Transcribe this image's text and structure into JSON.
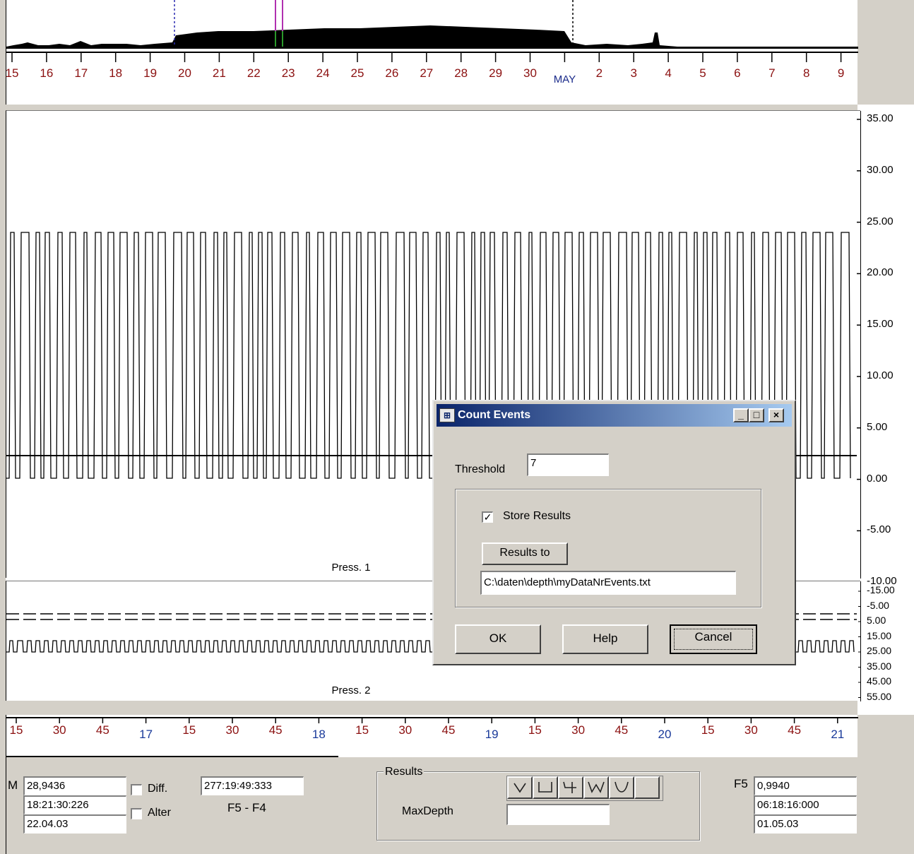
{
  "overview": {
    "date_ticks": [
      "15",
      "16",
      "17",
      "18",
      "19",
      "20",
      "21",
      "22",
      "23",
      "24",
      "25",
      "26",
      "27",
      "28",
      "29",
      "30",
      "MAY",
      "2",
      "3",
      "4",
      "5",
      "6",
      "7",
      "8",
      "9"
    ]
  },
  "chart1": {
    "caption": "Press. 1",
    "y_ticks": [
      "35.00",
      "30.00",
      "25.00",
      "20.00",
      "15.00",
      "10.00",
      "5.00",
      "0.00",
      "-5.00",
      "-10.00"
    ]
  },
  "chart2": {
    "caption": "Press. 2",
    "y_ticks": [
      "-15.00",
      "-5.00",
      "5.00",
      "15.00",
      "25.00",
      "35.00",
      "45.00",
      "55.00"
    ]
  },
  "time_axis": {
    "ticks": [
      "15",
      "30",
      "45",
      "17",
      "15",
      "30",
      "45",
      "18",
      "15",
      "30",
      "45",
      "19",
      "15",
      "30",
      "45",
      "20",
      "15",
      "30",
      "45",
      "21"
    ]
  },
  "cursor_m": {
    "label": "M",
    "value": "28,9436",
    "time": "18:21:30:226",
    "date": "22.04.03"
  },
  "options": {
    "diff_label": "Diff.",
    "alter_label": "Alter"
  },
  "interval": {
    "value": "277:19:49:333",
    "label": "F5 - F4"
  },
  "results": {
    "group_label": "Results",
    "maxdepth_label": "MaxDepth",
    "maxdepth_value": "",
    "shape_buttons": [
      "v-shape-icon",
      "u-shape-icon",
      "hook-shape-icon",
      "w-shape-icon",
      "cup-shape-icon",
      "empty"
    ]
  },
  "cursor_f5": {
    "label": "F5",
    "value": "0,9940",
    "time": "06:18:16:000",
    "date": "01.05.03"
  },
  "dialog": {
    "title": "Count Events",
    "threshold_label": "Threshold",
    "threshold_value": "7",
    "store_results_label": "Store Results",
    "store_results_checked": true,
    "results_to_label": "Results to",
    "results_path": "C:\\daten\\depth\\myDataNrEvents.txt",
    "ok_label": "OK",
    "help_label": "Help",
    "cancel_label": "Cancel",
    "minimize": "_",
    "maximize": "□",
    "close": "×"
  }
}
